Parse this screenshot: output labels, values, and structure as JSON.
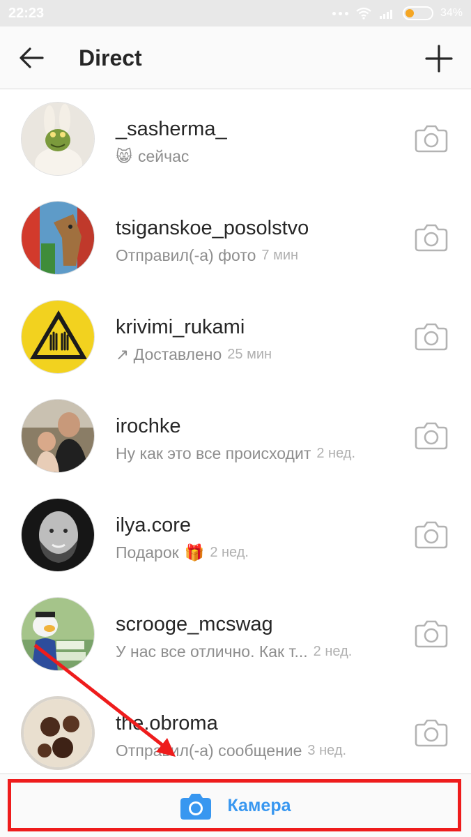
{
  "status_bar": {
    "time": "22:23",
    "battery": "34%"
  },
  "header": {
    "title": "Direct"
  },
  "conversations": [
    {
      "username": "_sasherma_",
      "preview": "сейчас",
      "time": "",
      "emoji": "😸"
    },
    {
      "username": "tsiganskoe_posolstvo",
      "preview": "Отправил(-а) фото",
      "time": "7 мин",
      "emoji": ""
    },
    {
      "username": "krivimi_rukami",
      "preview": "↗ Доставлено",
      "time": "25 мин",
      "emoji": ""
    },
    {
      "username": "irochke",
      "preview": "Ну как это все происходит",
      "time": "2 нед.",
      "emoji": ""
    },
    {
      "username": "ilya.core",
      "preview": "Подарок",
      "time": "2 нед.",
      "emoji": "🎁"
    },
    {
      "username": "scrooge_mcswag",
      "preview": "У нас все отлично. Как т...",
      "time": "2 нед.",
      "emoji": ""
    },
    {
      "username": "the.obroma",
      "preview": "Отправил(-а) сообщение",
      "time": "3 нед.",
      "emoji": ""
    }
  ],
  "bottom_bar": {
    "camera_label": "Камера"
  },
  "colors": {
    "accent": "#3897f0",
    "highlight": "#ee1c1c",
    "text": "#262626",
    "secondary": "#8e8e8e"
  },
  "icons": [
    "back-arrow-icon",
    "plus-icon",
    "camera-outline-icon",
    "camera-filled-icon",
    "wifi-icon",
    "signal-icon",
    "battery-icon"
  ]
}
